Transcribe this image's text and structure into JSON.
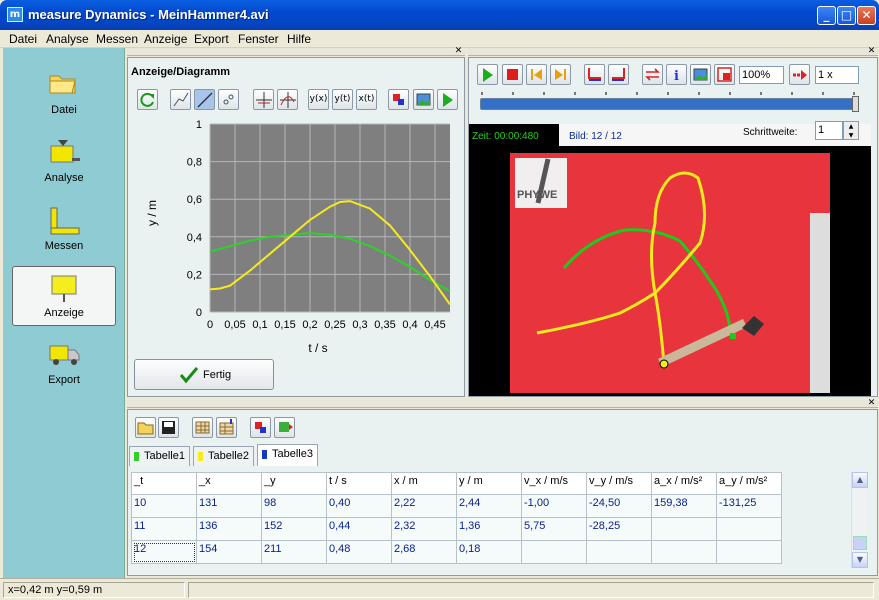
{
  "window": {
    "title": "measure Dynamics - MeinHammer4.avi",
    "app_icon": "m"
  },
  "menu": [
    "Datei",
    "Analyse",
    "Messen",
    "Anzeige",
    "Export",
    "Fenster",
    "Hilfe"
  ],
  "sidebar": [
    {
      "label": "Datei",
      "icon": "folder-icon"
    },
    {
      "label": "Analyse",
      "icon": "analyse-icon"
    },
    {
      "label": "Messen",
      "icon": "ruler-icon"
    },
    {
      "label": "Anzeige",
      "icon": "signboard-icon"
    },
    {
      "label": "Export",
      "icon": "truck-icon"
    }
  ],
  "diagram": {
    "heading": "Anzeige/Diagramm",
    "toolbar": [
      "refresh-icon",
      "scatter-line-icon",
      "line-icon",
      "points-icon",
      "crosshair-icon",
      "curve-cross-icon",
      "y(x)",
      "y(t)",
      "x(t)",
      "settings-icon",
      "image-export-icon",
      "play-icon"
    ],
    "done_label": "Fertig"
  },
  "chart_data": {
    "type": "line",
    "xlabel": "t / s",
    "ylabel": "y / m",
    "xlim": [
      0,
      0.48
    ],
    "ylim": [
      0,
      1
    ],
    "xticks": [
      "0",
      "0,05",
      "0,1",
      "0,15",
      "0,2",
      "0,25",
      "0,3",
      "0,35",
      "0,4",
      "0,45"
    ],
    "yticks": [
      "0",
      "0,2",
      "0,4",
      "0,6",
      "0,8",
      "1"
    ],
    "grid": true,
    "background": "#7f7f7f",
    "series": [
      {
        "color": "#2fd12a",
        "x": [
          0,
          0.04,
          0.08,
          0.12,
          0.16,
          0.2,
          0.24,
          0.28,
          0.32,
          0.36,
          0.4,
          0.44,
          0.48
        ],
        "values": [
          0.32,
          0.35,
          0.38,
          0.4,
          0.41,
          0.42,
          0.41,
          0.39,
          0.35,
          0.3,
          0.24,
          0.17,
          0.11
        ]
      },
      {
        "color": "#f5ea1f",
        "x": [
          0,
          0.02,
          0.04,
          0.08,
          0.12,
          0.16,
          0.2,
          0.24,
          0.26,
          0.28,
          0.32,
          0.36,
          0.4,
          0.44,
          0.48
        ],
        "values": [
          0.12,
          0.125,
          0.14,
          0.22,
          0.31,
          0.4,
          0.49,
          0.56,
          0.585,
          0.59,
          0.55,
          0.46,
          0.33,
          0.19,
          0.04
        ]
      }
    ]
  },
  "video": {
    "toolbar": [
      "play-icon",
      "stop-icon",
      "first-frame-icon",
      "last-frame-icon",
      "mark-start-icon",
      "mark-end-icon",
      "swap-icon",
      "info-icon",
      "image-icon",
      "resize-icon",
      "zoom-value",
      "forward-icon",
      "speed-value"
    ],
    "zoom": "100%",
    "speed": "1 x",
    "zeit": "Zeit:  00:00:480",
    "bild": "Bild: 12 / 12",
    "schrittweite_label": "Schrittweite:",
    "schrittweite": "1",
    "logo": "PHYWE"
  },
  "table_toolbar": [
    "open-folder-icon",
    "save-icon",
    "table-grid-icon",
    "table-add-icon",
    "settings-icon",
    "export-flag-icon"
  ],
  "tabs": [
    {
      "label": "Tabelle1",
      "color": "#2fd12a"
    },
    {
      "label": "Tabelle2",
      "color": "#f5ea1f"
    },
    {
      "label": "Tabelle3",
      "color": "#1238c4"
    }
  ],
  "table": {
    "headers": [
      "_t",
      "_x",
      "_y",
      "t / s",
      "x / m",
      "y / m",
      "v_x / m/s",
      "v_y / m/s",
      "a_x / m/s²",
      "a_y / m/s²"
    ],
    "rows": [
      [
        "10",
        "131",
        "98",
        "0,40",
        "2,22",
        "2,44",
        "-1,00",
        "-24,50",
        "159,38",
        "-131,25"
      ],
      [
        "11",
        "136",
        "152",
        "0,44",
        "2,32",
        "1,36",
        "5,75",
        "-28,25",
        "",
        ""
      ],
      [
        "12",
        "154",
        "211",
        "0,48",
        "2,68",
        "0,18",
        "",
        "",
        "",
        ""
      ]
    ]
  },
  "status": {
    "coords": "x=0,42 m  y=0,59 m"
  }
}
